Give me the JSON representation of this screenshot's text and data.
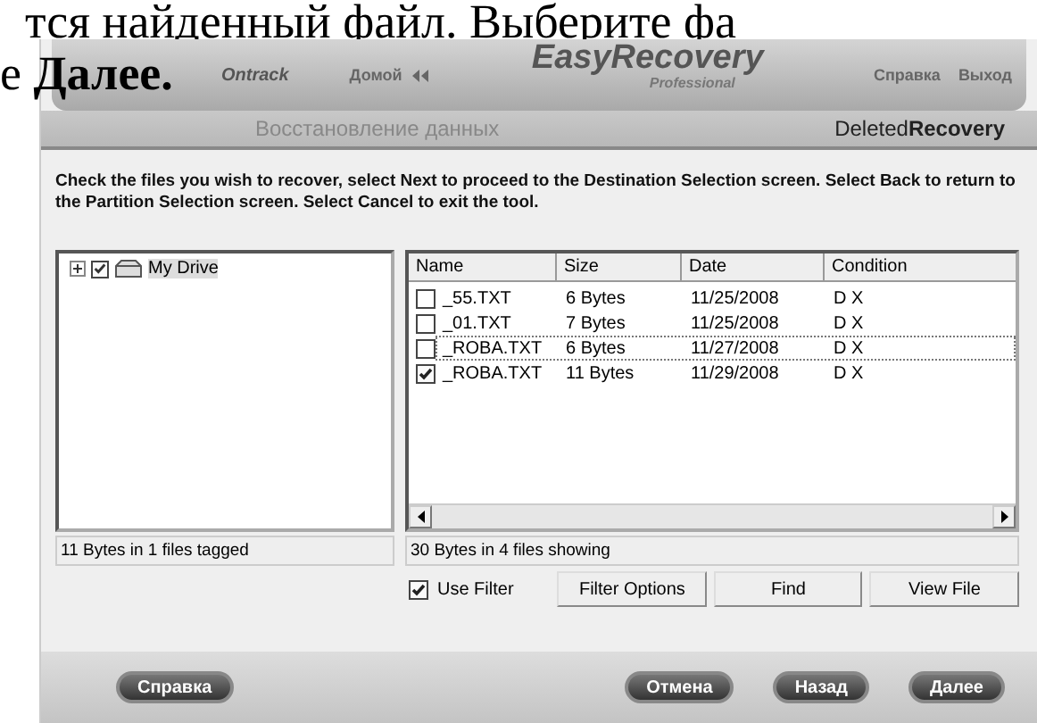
{
  "document_text": [
    "тся найденный файл. Выберите фа",
    "е **Далее.**"
  ],
  "header": {
    "logo": "Ontrack",
    "product": "EasyRecovery",
    "edition": "Professional",
    "home": "Домой",
    "links": [
      "Справка",
      "Выход"
    ]
  },
  "subheader": {
    "section": "Восстановление данных",
    "module": "Deleted**Recovery**"
  },
  "instructions": "Check the files you wish to recover, select Next to proceed to the Destination Selection screen. Select Back to return to the Partition Selection screen. Select Cancel to exit the tool.",
  "tree": [
    {
      "label": "My Drive",
      "checked": true,
      "expanded": false,
      "selected": true
    }
  ],
  "table": {
    "columns": [
      "Name",
      "Size",
      "Date",
      "Condition"
    ],
    "rows": [
      {
        "cells": [
          "_55.TXT",
          "6 Bytes",
          "11/25/2008",
          "D X"
        ],
        "checked": false,
        "focused": false
      },
      {
        "cells": [
          "_01.TXT",
          "7 Bytes",
          "11/25/2008",
          "D X"
        ],
        "checked": false,
        "focused": false
      },
      {
        "cells": [
          "_ROBA.TXT",
          "6 Bytes",
          "11/27/2008",
          "D X"
        ],
        "checked": false,
        "focused": true
      },
      {
        "cells": [
          "_ROBA.TXT",
          "11 Bytes",
          "11/29/2008",
          "D X"
        ],
        "checked": true,
        "focused": false
      }
    ]
  },
  "status_left": "11 Bytes in 1 files tagged",
  "status_right": "30 Bytes in 4 files showing",
  "use_filter": {
    "label": "Use Filter",
    "checked": true
  },
  "tool_buttons": [
    "Filter Options",
    "Find",
    "View File"
  ],
  "footer_buttons": {
    "help": "Справка",
    "actions": [
      "Отмена",
      "Назад",
      "Далее"
    ]
  }
}
